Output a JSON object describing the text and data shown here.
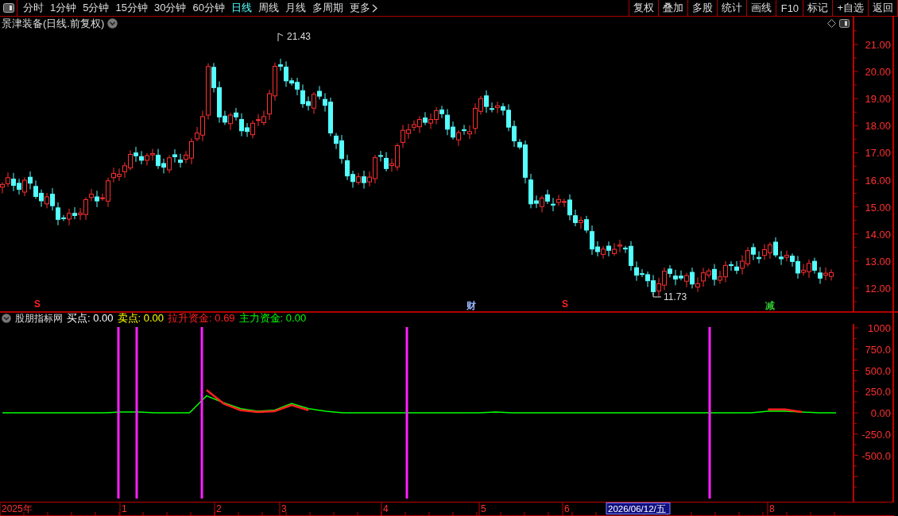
{
  "toolbar": {
    "periods": [
      {
        "label": "分时",
        "selected": false
      },
      {
        "label": "1分钟",
        "selected": false
      },
      {
        "label": "5分钟",
        "selected": false
      },
      {
        "label": "15分钟",
        "selected": false
      },
      {
        "label": "30分钟",
        "selected": false
      },
      {
        "label": "60分钟",
        "selected": false
      },
      {
        "label": "日线",
        "selected": true
      },
      {
        "label": "周线",
        "selected": false
      },
      {
        "label": "月线",
        "selected": false
      },
      {
        "label": "多周期",
        "selected": false
      },
      {
        "label": "更多",
        "selected": false
      }
    ],
    "buttons": [
      "复权",
      "叠加",
      "多股",
      "统计",
      "画线",
      "F10",
      "标记",
      "+自选",
      "返回"
    ]
  },
  "price_pane": {
    "title": "景津装备(日线.前复权)",
    "axis_labels": [
      "21.00",
      "20.00",
      "19.00",
      "18.00",
      "17.00",
      "16.00",
      "15.00",
      "14.00",
      "13.00",
      "12.00"
    ],
    "high_label": "21.43",
    "low_label": "11.73",
    "event_markers": [
      {
        "text": "S",
        "color": "#ff2020"
      },
      {
        "text": "财",
        "color": "#9ab8ff"
      },
      {
        "text": "S",
        "color": "#ff2020"
      },
      {
        "text": "减",
        "color": "#30c030"
      }
    ]
  },
  "indicator_pane": {
    "name": "股朋指标网",
    "values": [
      {
        "label": "买点:",
        "value": "0.00",
        "color": "#ffffff"
      },
      {
        "label": "卖点:",
        "value": "0.00",
        "color": "#ffff00"
      },
      {
        "label": "拉升资金:",
        "value": "0.69",
        "color": "#ff2020"
      },
      {
        "label": "主力资金:",
        "value": "0.00",
        "color": "#00ff00"
      }
    ],
    "chart_data": {
      "type": "line",
      "categories": [
        null,
        null,
        null,
        null,
        null,
        null,
        null,
        null,
        null,
        null,
        null,
        null,
        null,
        null,
        null,
        null,
        null,
        null,
        null,
        null,
        null,
        null,
        null,
        null,
        null,
        null,
        null,
        null,
        null,
        null,
        null,
        null,
        null,
        null,
        null,
        null,
        null,
        null,
        null,
        null,
        null,
        null,
        null,
        null,
        null,
        null,
        null,
        null,
        null,
        null
      ],
      "ylim": [
        -1046,
        1047
      ],
      "yticks": [
        {
          "value": 1000,
          "label": "1000"
        },
        {
          "value": 750,
          "label": "750.0"
        },
        {
          "value": 500,
          "label": "500.0"
        },
        {
          "value": 250,
          "label": "250.0"
        },
        {
          "value": 0,
          "label": "0.00"
        },
        {
          "value": -250,
          "label": "-250.0"
        },
        {
          "value": -500,
          "label": "-500.0"
        }
      ],
      "series": [
        {
          "color": "#ff2020",
          "values": [
            null,
            null,
            null,
            null,
            null,
            null,
            null,
            null,
            null,
            null,
            null,
            null,
            270,
            110,
            30,
            10,
            20,
            90,
            30,
            null,
            null,
            null,
            null,
            null,
            null,
            null,
            null,
            null,
            null,
            null,
            null,
            null,
            null,
            null,
            null,
            null,
            null,
            null,
            null,
            null,
            null,
            null,
            null,
            null,
            null,
            40,
            40,
            10,
            null,
            null
          ]
        },
        {
          "color": "#00ff00",
          "values": [
            0,
            0,
            0,
            0,
            0,
            0,
            0,
            10,
            10,
            0,
            0,
            0,
            200,
            120,
            50,
            20,
            30,
            110,
            50,
            20,
            0,
            0,
            0,
            0,
            0,
            0,
            0,
            0,
            0,
            10,
            0,
            0,
            0,
            0,
            0,
            0,
            0,
            0,
            0,
            0,
            0,
            0,
            0,
            0,
            0,
            20,
            20,
            10,
            0,
            0
          ]
        }
      ]
    }
  },
  "date_axis": {
    "labels": [
      "2025年",
      "1",
      "2",
      "3",
      "4",
      "5",
      "6",
      "8"
    ],
    "cursor": "2026/06/12/五"
  }
}
